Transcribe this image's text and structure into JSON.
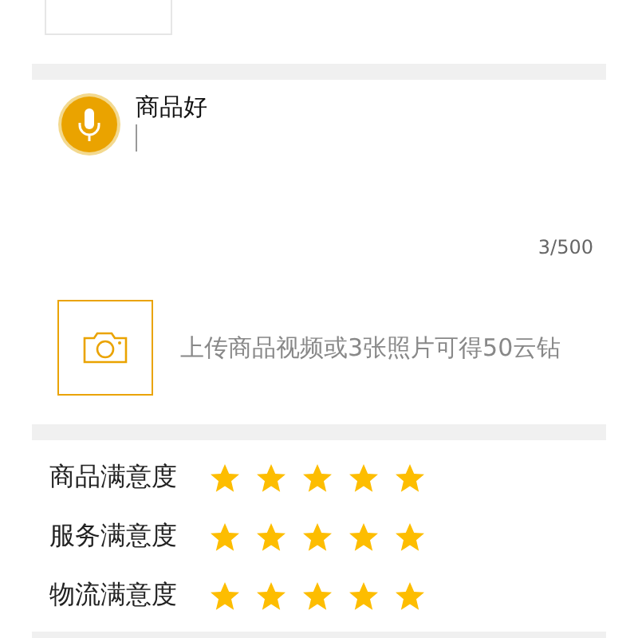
{
  "review": {
    "value": "商品好",
    "count": "3/500"
  },
  "upload": {
    "hint": "上传商品视频或3张照片可得50云钻"
  },
  "ratings": [
    {
      "label": "商品满意度",
      "stars": 5
    },
    {
      "label": "服务满意度",
      "stars": 5
    },
    {
      "label": "物流满意度",
      "stars": 5
    }
  ]
}
